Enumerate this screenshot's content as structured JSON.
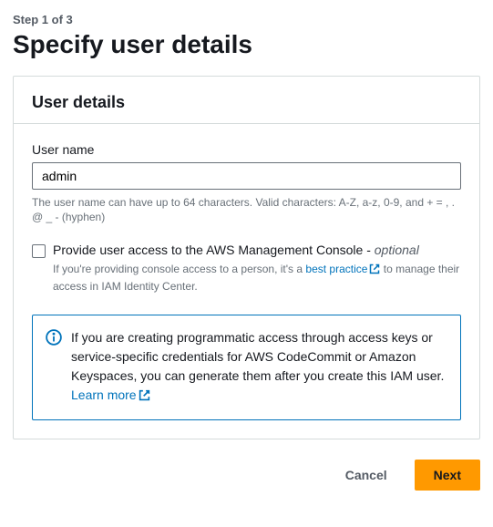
{
  "step_label": "Step 1 of 3",
  "page_title": "Specify user details",
  "panel": {
    "header": "User details",
    "username_label": "User name",
    "username_value": "admin",
    "username_help": "The user name can have up to 64 characters. Valid characters: A-Z, a-z, 0-9, and + = , . @ _ - (hyphen)",
    "console_access_label_pre": "Provide user access to the AWS Management Console - ",
    "console_access_optional": "optional",
    "console_help_pre": "If you're providing console access to a person, it's a ",
    "console_help_link": "best practice",
    "console_help_post": " to manage their access in IAM Identity Center.",
    "info_text": "If you are creating programmatic access through access keys or service-specific credentials for AWS CodeCommit or Amazon Keyspaces, you can generate them after you create this IAM user. ",
    "info_link": "Learn more"
  },
  "footer": {
    "cancel": "Cancel",
    "next": "Next"
  }
}
